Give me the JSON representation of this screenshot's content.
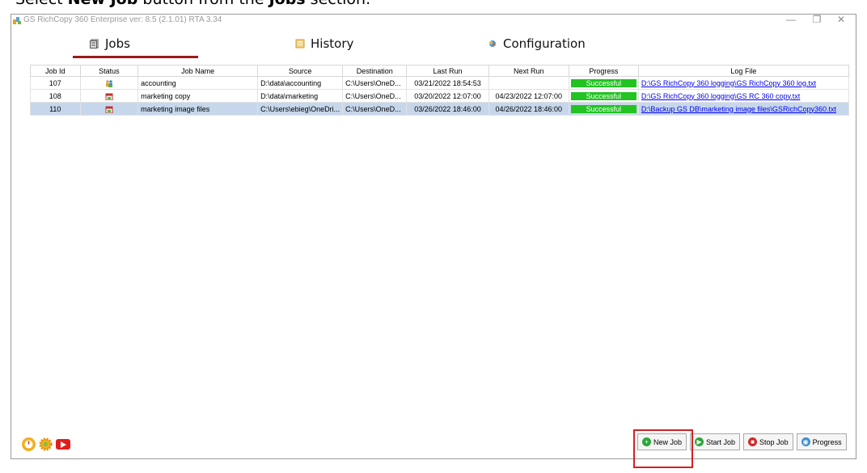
{
  "caption": {
    "pre": "Select ",
    "b1": "New Job",
    "mid": " button from the ",
    "b2": "Jobs",
    "post": " section."
  },
  "window": {
    "title": "GS RichCopy 360 Enterprise ver: 8.5 (2.1.01) RTA 3.34"
  },
  "tabs": [
    {
      "label": "Jobs",
      "icon": "jobs-icon",
      "active": true
    },
    {
      "label": "History",
      "icon": "history-icon"
    },
    {
      "label": "Configuration",
      "icon": "configuration-icon"
    }
  ],
  "table": {
    "headers": [
      "Job Id",
      "Status",
      "Job Name",
      "Source",
      "Destination",
      "Last Run",
      "Next Run",
      "Progress",
      "Log File"
    ],
    "rows": [
      {
        "id": "107",
        "status": "users-status-icon",
        "name": "accounting",
        "source": "D:\\data\\accounting",
        "destination": "C:\\Users\\OneD...",
        "last_run": "03/21/2022 18:54:53",
        "next_run": "",
        "progress": "Successful",
        "log": "D:\\GS RichCopy 360 logging\\GS RichCopy 360 log.txt"
      },
      {
        "id": "108",
        "status": "calendar-status-icon",
        "name": "marketing copy",
        "source": "D:\\data\\marketing",
        "destination": "C:\\Users\\OneD...",
        "last_run": "03/20/2022 12:07:00",
        "next_run": "04/23/2022 12:07:00",
        "progress": "Successful",
        "log": "D:\\GS RichCopy 360 logging\\GS RC 360 copy.txt"
      },
      {
        "id": "110",
        "status": "calendar-status-icon",
        "name": "marketing image files",
        "source": "C:\\Users\\ebieg\\OneDri...",
        "destination": "C:\\Users\\OneD...",
        "last_run": "03/26/2022 18:46:00",
        "next_run": "04/26/2022 18:46:00",
        "progress": "Successful",
        "log": "D:\\Backup GS DB\\marketing image files\\GSRichCopy360.txt"
      }
    ]
  },
  "buttons": {
    "new_job": "New Job",
    "start_job": "Start Job",
    "stop_job": "Stop Job",
    "progress": "Progress"
  },
  "colors": {
    "accent": "#9c1b1b",
    "success": "#22c322",
    "selected_row": "#c6d7ec",
    "highlight": "#d62020"
  }
}
